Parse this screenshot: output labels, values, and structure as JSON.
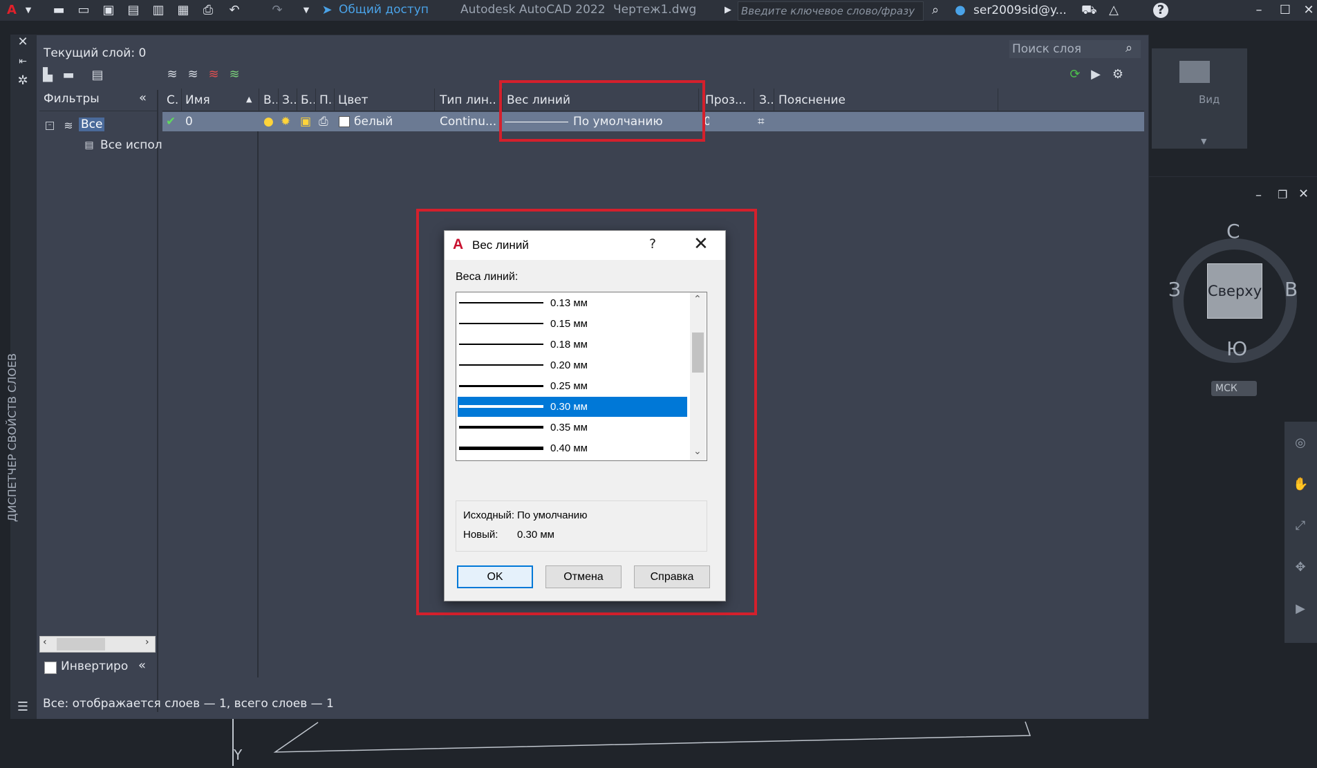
{
  "titlebar": {
    "app_title": "Autodesk AutoCAD 2022",
    "file_name": "Чертеж1.dwg",
    "share_label": "Общий доступ",
    "search_placeholder": "Введите ключевое слово/фразу",
    "user": "ser2009sid@y...",
    "help": "?"
  },
  "ribbon": {
    "view_label": "Вид"
  },
  "viewcube": {
    "top_face": "Сверху",
    "north": "С",
    "south": "Ю",
    "west": "З",
    "east": "В",
    "ucs": "МСК"
  },
  "layer_palette": {
    "vertical_title": "ДИСПЕТЧЕР СВОЙСТВ СЛОЕВ",
    "current_layer": "Текущий слой: 0",
    "search_placeholder": "Поиск слоя",
    "filters_label": "Фильтры",
    "filter_tree": [
      "Все",
      "Все испол"
    ],
    "invert_label": "Инвертиро",
    "status": "Все: отображается слоев — 1, всего слоев — 1",
    "columns": [
      "С.",
      "Имя",
      "В..",
      "З..",
      "Б..",
      "П..",
      "Цвет",
      "Тип лин...",
      "Вес линий",
      "Проз...",
      "З..",
      "Пояснение"
    ],
    "row": {
      "name": "0",
      "color": "белый",
      "linetype": "Continu...",
      "lineweight": "По умолчанию",
      "transparency": "0"
    }
  },
  "dialog": {
    "title": "Вес линий",
    "help_button": "?",
    "list_label": "Веса линий:",
    "items": [
      {
        "label": "0.13 мм",
        "weight": 0.13
      },
      {
        "label": "0.15 мм",
        "weight": 0.15
      },
      {
        "label": "0.18 мм",
        "weight": 0.18
      },
      {
        "label": "0.20 мм",
        "weight": 0.2
      },
      {
        "label": "0.25 мм",
        "weight": 0.25
      },
      {
        "label": "0.30 мм",
        "weight": 0.3
      },
      {
        "label": "0.35 мм",
        "weight": 0.35
      },
      {
        "label": "0.40 мм",
        "weight": 0.4
      }
    ],
    "selected_index": 5,
    "original_label": "Исходный:",
    "original_value": "По умолчанию",
    "new_label": "Новый:",
    "new_value": "0.30 мм",
    "ok": "OK",
    "cancel": "Отмена",
    "help": "Справка"
  },
  "colors": {
    "selection": "#0078d7",
    "highlight_box": "#d4202c",
    "palette_bg": "#3c4250"
  }
}
